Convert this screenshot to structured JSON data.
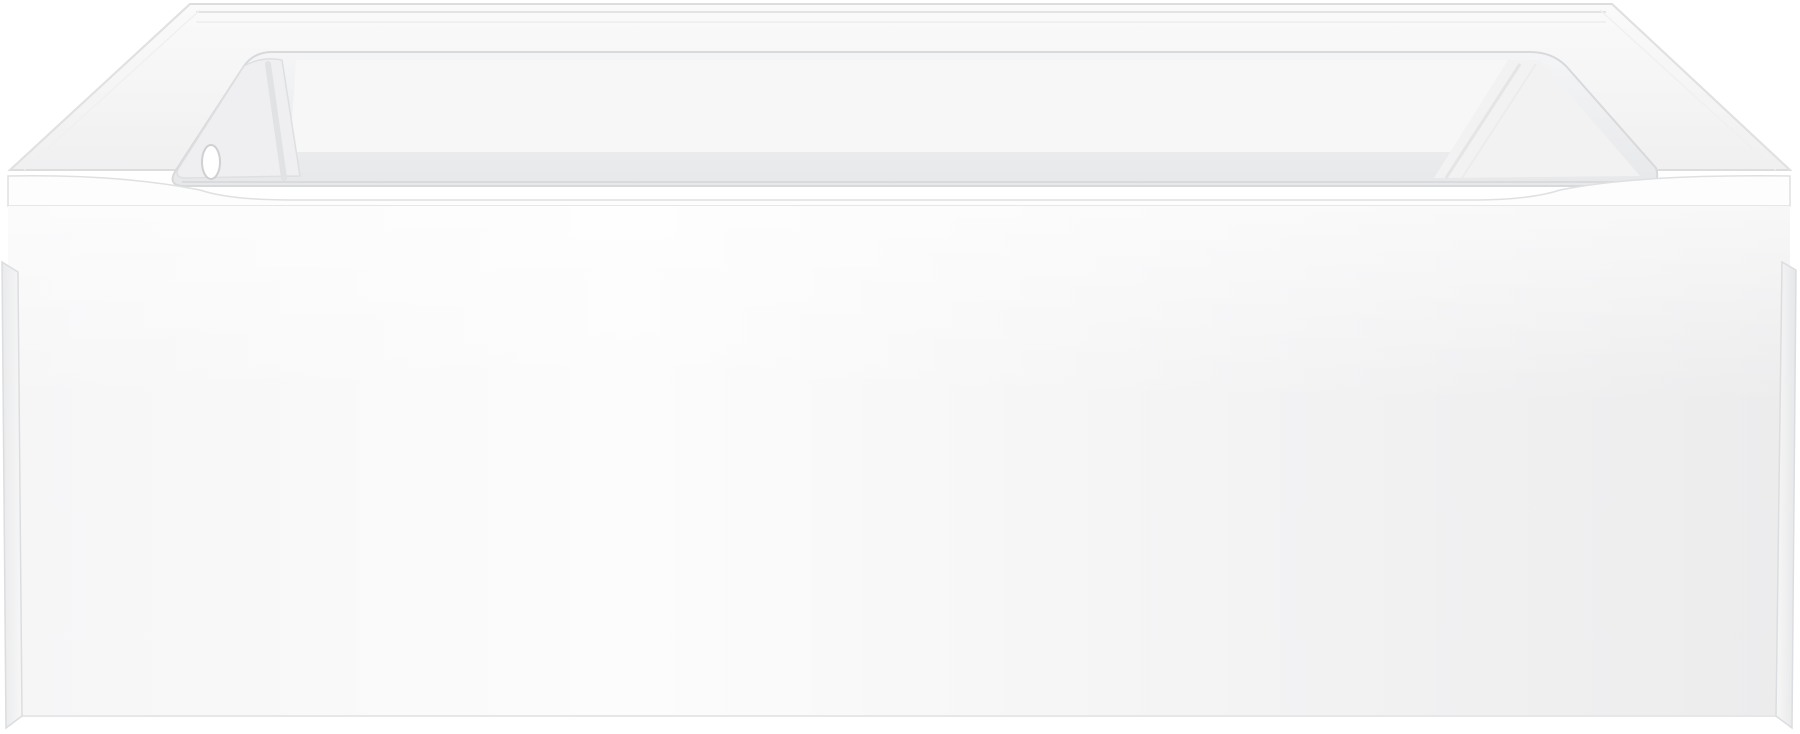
{
  "product": {
    "subject": "alcove-bathtub",
    "drain_side": "left",
    "finish": "white"
  },
  "palette": {
    "background": "#ffffff",
    "apron_light": "#fbfbfb",
    "apron_mid": "#f1f1f2",
    "basin_shadow": "#e4e5e7",
    "rim_edge": "#d9dadc",
    "drain_hole": "#ffffff"
  }
}
